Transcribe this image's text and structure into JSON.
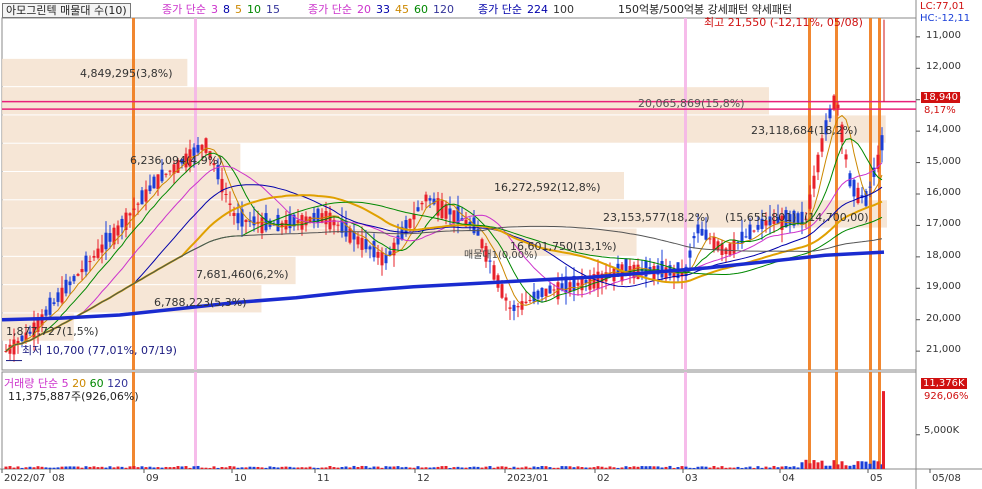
{
  "header": {
    "stock_name": "아모그린텍 매물대 수(10)",
    "ma_group1": {
      "label": "종가 단순",
      "periods": [
        "3",
        "8",
        "5",
        "10",
        "15"
      ],
      "colors": [
        "#cc33cc",
        "#0000aa",
        "#cc8800",
        "#008800",
        "#333399"
      ]
    },
    "ma_group2": {
      "label": "종가 단순",
      "periods": [
        "20",
        "33",
        "45",
        "60",
        "120"
      ],
      "colors": [
        "#cc33cc",
        "#0000aa",
        "#cc8800",
        "#008800",
        "#333399"
      ]
    },
    "ma_group3": {
      "label": "종가 단순",
      "periods": [
        "224",
        "100"
      ]
    },
    "pattern_text": "150억봉/500억봉  강세패턴   약세패턴",
    "lc_value": "LC:77,01",
    "hc_value": "HC:-12,11"
  },
  "price_axis": [
    "21,000",
    "20,000",
    "19,000",
    "18,000",
    "17,000",
    "16,000",
    "15,000",
    "14,000",
    "13,000",
    "12,000",
    "11,000"
  ],
  "price_tags": {
    "current": "18,940",
    "current_pct": "8,17%"
  },
  "volume_axis": [
    "5,000K"
  ],
  "volume_tags": {
    "current": "11,376K",
    "current_pct": "926,06%"
  },
  "volume_legend": {
    "label": "거래량",
    "ma_label": "단순",
    "periods": [
      "5",
      "20",
      "60",
      "120"
    ],
    "value_text": "11,375,887주(926,06%)"
  },
  "date_axis": [
    "2022/07",
    "08",
    "09",
    "10",
    "11",
    "12",
    "2023/01",
    "02",
    "03",
    "04",
    "05",
    "05/08"
  ],
  "annotations": {
    "max": "최고 21,550 (-12,11%, 05/08)",
    "min": "최저 10,700 (77,01%, 07/19)",
    "vp": [
      "4,849,295(3,8%)",
      "20,065,869(15,8%)",
      "23,118,684(18,2%)",
      "6,236,094(4,9%)",
      "16,272,592(12,8%)",
      "23,153,577(18,2%)",
      "(15,655,801)",
      "(14,700,00)",
      "16,601,750(13,1%)",
      "7,681,460(6,2%)",
      "6,788,223(5,3%)",
      "1,877,727(1,5%)",
      "매물대1(0,00%)"
    ]
  },
  "chart_data": {
    "type": "candlestick",
    "x_range": [
      "2022/07/01",
      "2023/05/08"
    ],
    "ylim": [
      10400,
      21600
    ],
    "y_ticks": [
      11000,
      12000,
      13000,
      14000,
      15000,
      16000,
      17000,
      18000,
      19000,
      20000,
      21000
    ],
    "high": 21550,
    "low": 10700,
    "last_close": 18940,
    "horizontal_lines": [
      18940,
      18700
    ],
    "volume_profile": [
      {
        "price_low": 19400,
        "price_high": 20300,
        "volume": 4849295,
        "pct": 3.8
      },
      {
        "price_low": 18500,
        "price_high": 19400,
        "volume": 20065869,
        "pct": 15.8
      },
      {
        "price_low": 17600,
        "price_high": 18500,
        "volume": 23118684,
        "pct": 18.2
      },
      {
        "price_low": 16700,
        "price_high": 17600,
        "volume": 6236094,
        "pct": 4.9
      },
      {
        "price_low": 15800,
        "price_high": 16700,
        "volume": 16272592,
        "pct": 12.8
      },
      {
        "price_low": 14900,
        "price_high": 15800,
        "volume": 23153577,
        "pct": 18.2
      },
      {
        "price_low": 14000,
        "price_high": 14900,
        "volume": 16601750,
        "pct": 13.1
      },
      {
        "price_low": 13100,
        "price_high": 14000,
        "volume": 7681460,
        "pct": 6.2
      },
      {
        "price_low": 12200,
        "price_high": 13100,
        "volume": 6788223,
        "pct": 5.3
      },
      {
        "price_low": 11300,
        "price_high": 12200,
        "volume": 1877727,
        "pct": 1.5
      }
    ],
    "ma224_points": [
      12000,
      12050,
      12150,
      12350,
      12550,
      12700,
      12900,
      13050,
      13150,
      13250,
      13350,
      13500,
      13650,
      13850,
      14050,
      14150
    ],
    "volume_last": 11375887,
    "volume_axis_tick": 5000000
  },
  "colors": {
    "up": "#e8202a",
    "down": "#1a3fd8",
    "ma224": "#1a2bd0",
    "vp_fill": "#f5e2cf",
    "pink_line": "#e8207a",
    "orange_bar": "#f07a1a",
    "pink_bar": "#f5b5e8"
  }
}
